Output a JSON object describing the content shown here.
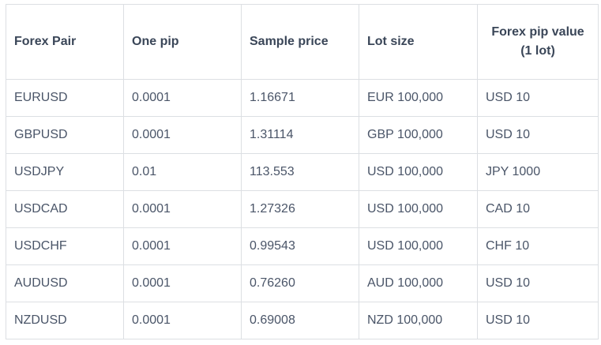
{
  "table": {
    "headers": [
      "Forex Pair",
      "One pip",
      "Sample price",
      "Lot size",
      "Forex pip value (1 lot)"
    ],
    "rows": [
      [
        "EURUSD",
        "0.0001",
        "1.16671",
        "EUR 100,000",
        "USD 10"
      ],
      [
        "GBPUSD",
        "0.0001",
        "1.31114",
        "GBP 100,000",
        "USD 10"
      ],
      [
        "USDJPY",
        "0.01",
        "113.553",
        "USD 100,000",
        "JPY 1000"
      ],
      [
        "USDCAD",
        "0.0001",
        "1.27326",
        "USD 100,000",
        "CAD 10"
      ],
      [
        "USDCHF",
        "0.0001",
        "0.99543",
        "USD 100,000",
        "CHF 10"
      ],
      [
        "AUDUSD",
        "0.0001",
        "0.76260",
        "AUD 100,000",
        "USD 10"
      ],
      [
        "NZDUSD",
        "0.0001",
        "0.69008",
        "NZD 100,000",
        "USD 10"
      ]
    ]
  }
}
